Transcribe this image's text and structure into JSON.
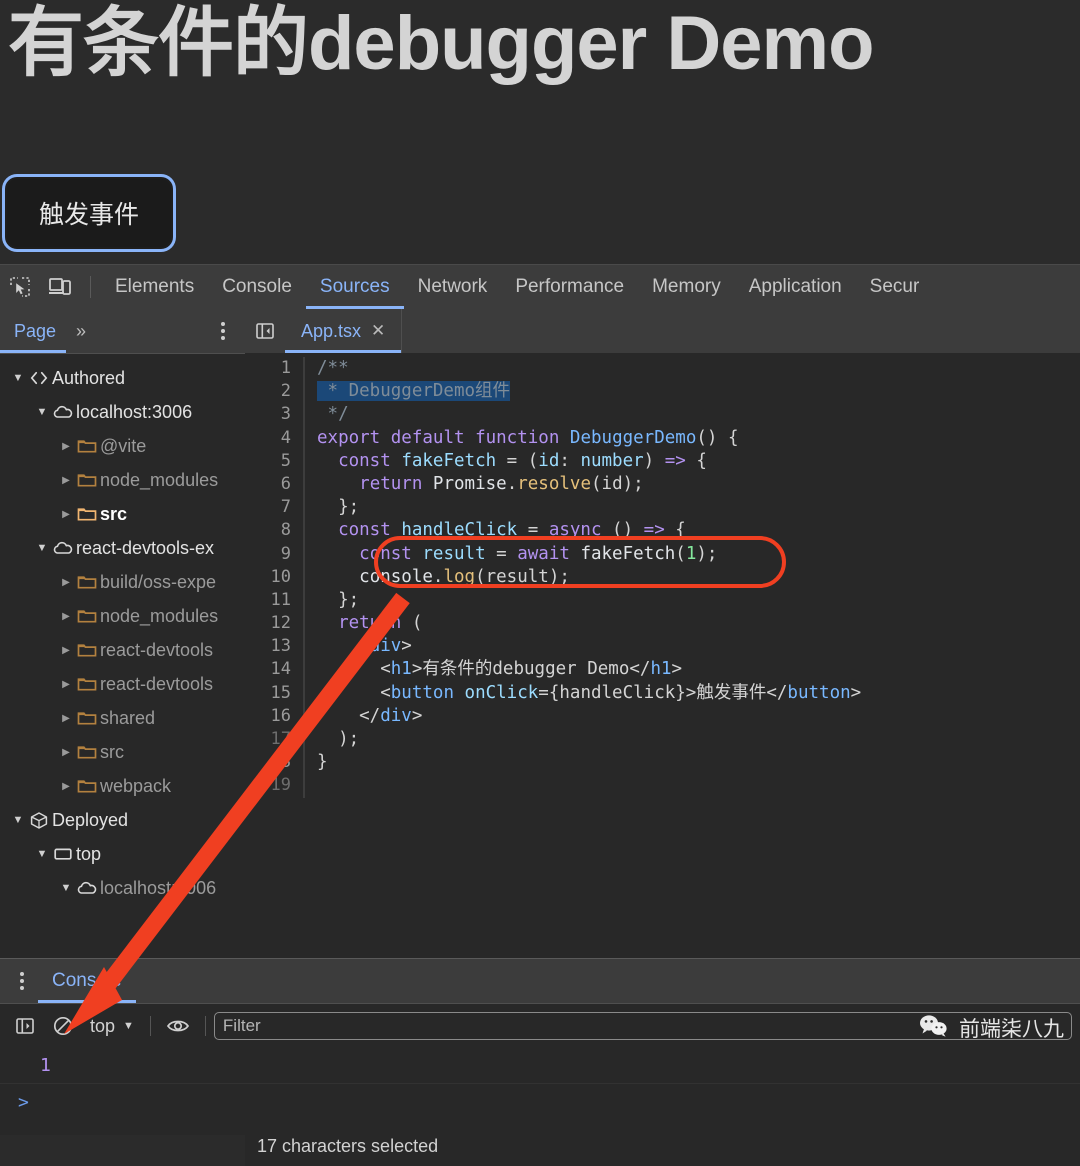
{
  "page": {
    "title": "有条件的debugger Demo",
    "button_label": "触发事件"
  },
  "devtools": {
    "main_tabs": [
      {
        "label": "Elements",
        "active": false
      },
      {
        "label": "Console",
        "active": false
      },
      {
        "label": "Sources",
        "active": true
      },
      {
        "label": "Network",
        "active": false
      },
      {
        "label": "Performance",
        "active": false
      },
      {
        "label": "Memory",
        "active": false
      },
      {
        "label": "Application",
        "active": false
      },
      {
        "label": "Secur",
        "active": false
      }
    ],
    "icons": {
      "inspect": "inspect-element-icon",
      "device": "device-toolbar-icon",
      "more": "more-tabs-icon",
      "kebab": "more-options-icon"
    },
    "navigator": {
      "tab_label": "Page",
      "more_label": "»",
      "tree": [
        {
          "label": "Authored",
          "indent": 0,
          "twisty": "open",
          "icon": "code-brackets-icon",
          "style": "bright"
        },
        {
          "label": "localhost:3006",
          "indent": 1,
          "twisty": "open",
          "icon": "cloud-icon",
          "style": "bright"
        },
        {
          "label": "@vite",
          "indent": 2,
          "twisty": "closed",
          "icon": "folder-icon",
          "style": "dim"
        },
        {
          "label": "node_modules",
          "indent": 2,
          "twisty": "closed",
          "icon": "folder-icon",
          "style": "dim"
        },
        {
          "label": "src",
          "indent": 2,
          "twisty": "closed",
          "icon": "folder-icon-active",
          "style": "sel"
        },
        {
          "label": "react-devtools-ex",
          "indent": 1,
          "twisty": "open",
          "icon": "cloud-icon",
          "style": "bright"
        },
        {
          "label": "build/oss-expe",
          "indent": 2,
          "twisty": "closed",
          "icon": "folder-icon",
          "style": "dim"
        },
        {
          "label": "node_modules",
          "indent": 2,
          "twisty": "closed",
          "icon": "folder-icon",
          "style": "dim"
        },
        {
          "label": "react-devtools",
          "indent": 2,
          "twisty": "closed",
          "icon": "folder-icon",
          "style": "dim"
        },
        {
          "label": "react-devtools",
          "indent": 2,
          "twisty": "closed",
          "icon": "folder-icon",
          "style": "dim"
        },
        {
          "label": "shared",
          "indent": 2,
          "twisty": "closed",
          "icon": "folder-icon",
          "style": "dim"
        },
        {
          "label": "src",
          "indent": 2,
          "twisty": "closed",
          "icon": "folder-icon",
          "style": "dim"
        },
        {
          "label": "webpack",
          "indent": 2,
          "twisty": "closed",
          "icon": "folder-icon",
          "style": "dim"
        },
        {
          "label": "Deployed",
          "indent": 0,
          "twisty": "open",
          "icon": "cube-icon",
          "style": "bright"
        },
        {
          "label": "top",
          "indent": 1,
          "twisty": "open",
          "icon": "frame-icon",
          "style": "bright"
        },
        {
          "label": "localhost:3006",
          "indent": 2,
          "twisty": "open",
          "icon": "cloud-icon",
          "style": "dim"
        }
      ]
    },
    "editor": {
      "tab_label": "App.tsx",
      "close_label": "✕",
      "panel_toggle_icon": "show-navigator-icon",
      "lines": [
        {
          "n": "1",
          "tokens": [
            {
              "t": "/**",
              "c": "cmt"
            }
          ]
        },
        {
          "n": "2",
          "selected": true,
          "tokens": [
            {
              "t": " * DebuggerDemo组件",
              "c": "cmt"
            }
          ]
        },
        {
          "n": "3",
          "tokens": [
            {
              "t": " */",
              "c": "cmt"
            }
          ]
        },
        {
          "n": "4",
          "tokens": [
            {
              "t": "export",
              "c": "kw"
            },
            {
              "t": " ",
              "c": "txt"
            },
            {
              "t": "default",
              "c": "kw"
            },
            {
              "t": " ",
              "c": "txt"
            },
            {
              "t": "function",
              "c": "kw"
            },
            {
              "t": " ",
              "c": "txt"
            },
            {
              "t": "DebuggerDemo",
              "c": "fn"
            },
            {
              "t": "() {",
              "c": "txt"
            }
          ]
        },
        {
          "n": "5",
          "tokens": [
            {
              "t": "  ",
              "c": "txt"
            },
            {
              "t": "const",
              "c": "kw"
            },
            {
              "t": " ",
              "c": "txt"
            },
            {
              "t": "fakeFetch",
              "c": "var"
            },
            {
              "t": " = (",
              "c": "txt"
            },
            {
              "t": "id",
              "c": "var"
            },
            {
              "t": ": ",
              "c": "txt"
            },
            {
              "t": "number",
              "c": "var"
            },
            {
              "t": ") ",
              "c": "txt"
            },
            {
              "t": "=>",
              "c": "kw"
            },
            {
              "t": " {",
              "c": "txt"
            }
          ]
        },
        {
          "n": "6",
          "tokens": [
            {
              "t": "    ",
              "c": "txt"
            },
            {
              "t": "return",
              "c": "kw"
            },
            {
              "t": " ",
              "c": "txt"
            },
            {
              "t": "Promise",
              "c": "id"
            },
            {
              "t": ".",
              "c": "txt"
            },
            {
              "t": "resolve",
              "c": "meth"
            },
            {
              "t": "(id);",
              "c": "txt"
            }
          ]
        },
        {
          "n": "7",
          "tokens": [
            {
              "t": "  };",
              "c": "txt"
            }
          ]
        },
        {
          "n": "8",
          "tokens": [
            {
              "t": "  ",
              "c": "txt"
            },
            {
              "t": "const",
              "c": "kw"
            },
            {
              "t": " ",
              "c": "txt"
            },
            {
              "t": "handleClick",
              "c": "var"
            },
            {
              "t": " = ",
              "c": "txt"
            },
            {
              "t": "async",
              "c": "kw"
            },
            {
              "t": " () ",
              "c": "txt"
            },
            {
              "t": "=>",
              "c": "kw"
            },
            {
              "t": " {",
              "c": "txt"
            }
          ]
        },
        {
          "n": "9",
          "tokens": [
            {
              "t": "    ",
              "c": "txt"
            },
            {
              "t": "const",
              "c": "kw"
            },
            {
              "t": " ",
              "c": "txt"
            },
            {
              "t": "result",
              "c": "var"
            },
            {
              "t": " = ",
              "c": "txt"
            },
            {
              "t": "await",
              "c": "kw"
            },
            {
              "t": " ",
              "c": "txt"
            },
            {
              "t": "fakeFetch",
              "c": "id"
            },
            {
              "t": "(",
              "c": "txt"
            },
            {
              "t": "1",
              "c": "num"
            },
            {
              "t": ");",
              "c": "txt"
            }
          ]
        },
        {
          "n": "10",
          "tokens": [
            {
              "t": "    ",
              "c": "txt"
            },
            {
              "t": "console",
              "c": "id"
            },
            {
              "t": ".",
              "c": "txt"
            },
            {
              "t": "log",
              "c": "meth"
            },
            {
              "t": "(result);",
              "c": "txt"
            }
          ]
        },
        {
          "n": "11",
          "tokens": [
            {
              "t": "  };",
              "c": "txt"
            }
          ]
        },
        {
          "n": "12",
          "tokens": [
            {
              "t": "  ",
              "c": "txt"
            },
            {
              "t": "return",
              "c": "kw"
            },
            {
              "t": " (",
              "c": "txt"
            }
          ]
        },
        {
          "n": "13",
          "tokens": [
            {
              "t": "    <",
              "c": "txt"
            },
            {
              "t": "div",
              "c": "tag"
            },
            {
              "t": ">",
              "c": "txt"
            }
          ]
        },
        {
          "n": "14",
          "tokens": [
            {
              "t": "      <",
              "c": "txt"
            },
            {
              "t": "h1",
              "c": "tag"
            },
            {
              "t": ">",
              "c": "txt"
            },
            {
              "t": "有条件的debugger Demo",
              "c": "txt"
            },
            {
              "t": "</",
              "c": "txt"
            },
            {
              "t": "h1",
              "c": "tag"
            },
            {
              "t": ">",
              "c": "txt"
            }
          ]
        },
        {
          "n": "15",
          "tokens": [
            {
              "t": "      <",
              "c": "txt"
            },
            {
              "t": "button",
              "c": "tag"
            },
            {
              "t": " ",
              "c": "txt"
            },
            {
              "t": "onClick",
              "c": "var"
            },
            {
              "t": "={handleClick}>",
              "c": "txt"
            },
            {
              "t": "触发事件",
              "c": "txt"
            },
            {
              "t": "</",
              "c": "txt"
            },
            {
              "t": "button",
              "c": "tag"
            },
            {
              "t": ">",
              "c": "txt"
            }
          ]
        },
        {
          "n": "16",
          "tokens": [
            {
              "t": "    </",
              "c": "txt"
            },
            {
              "t": "div",
              "c": "tag"
            },
            {
              "t": ">",
              "c": "txt"
            }
          ]
        },
        {
          "n": "17",
          "dim": true,
          "tokens": [
            {
              "t": "  );",
              "c": "txt"
            }
          ]
        },
        {
          "n": "18",
          "tokens": [
            {
              "t": "}",
              "c": "txt"
            }
          ]
        },
        {
          "n": "19",
          "dim": true,
          "tokens": []
        }
      ]
    },
    "status_bar": {
      "text": "17 characters selected"
    },
    "drawer": {
      "tab_label": "Console",
      "kebab_icon": "more-tools-icon",
      "toolbar": {
        "sidebar_icon": "console-sidebar-icon",
        "clear_icon": "clear-console-icon",
        "context": "top",
        "caret": "▼",
        "eye_icon": "live-expression-icon",
        "filter_placeholder": "Filter"
      },
      "output": [
        {
          "value": "1",
          "type": "number"
        }
      ],
      "prompt": ">"
    }
  },
  "watermark": {
    "icon": "wechat-icon",
    "text": "前端柒八九"
  },
  "annotations": {
    "highlight_color": "#f03f21",
    "highlight_target": "const result = await fakeFetch(1); console.log(result);",
    "arrow": "points-from-code-highlight-to-console-output"
  }
}
